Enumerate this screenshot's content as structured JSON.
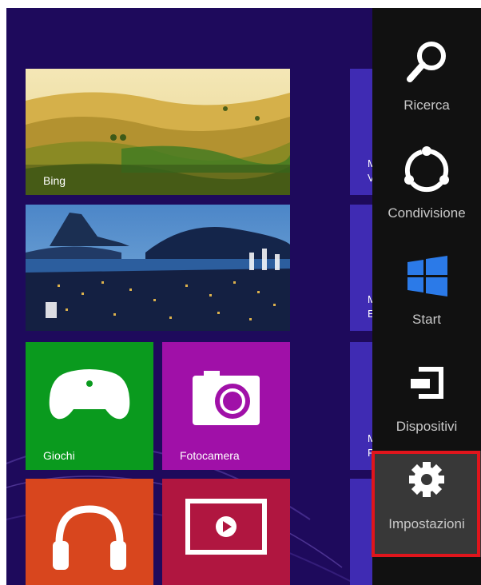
{
  "tiles": {
    "bing": {
      "label": "Bing"
    },
    "photo": {
      "label": ""
    },
    "games": {
      "label": "Giochi",
      "color": "#0a9a1e"
    },
    "camera": {
      "label": "Fotocamera",
      "color": "#a010a8"
    },
    "music": {
      "label": "",
      "color": "#d8461e"
    },
    "video": {
      "label": "",
      "color": "#b01640"
    }
  },
  "peek_tiles": [
    {
      "text": "M\nV"
    },
    {
      "text": "M\nE"
    },
    {
      "text": "M\nP"
    },
    {
      "text": ""
    }
  ],
  "charms": {
    "search": {
      "label": "Ricerca",
      "icon": "search-icon"
    },
    "share": {
      "label": "Condivisione",
      "icon": "share-icon"
    },
    "start": {
      "label": "Start",
      "icon": "windows-logo-icon"
    },
    "devices": {
      "label": "Dispositivi",
      "icon": "devices-icon"
    },
    "settings": {
      "label": "Impostazioni",
      "icon": "gear-icon",
      "highlight_color": "#e0151c"
    }
  },
  "colors": {
    "start_background": "#1e0a5c",
    "charms_bar": "#111111",
    "windows_blue": "#2b7ae8"
  }
}
